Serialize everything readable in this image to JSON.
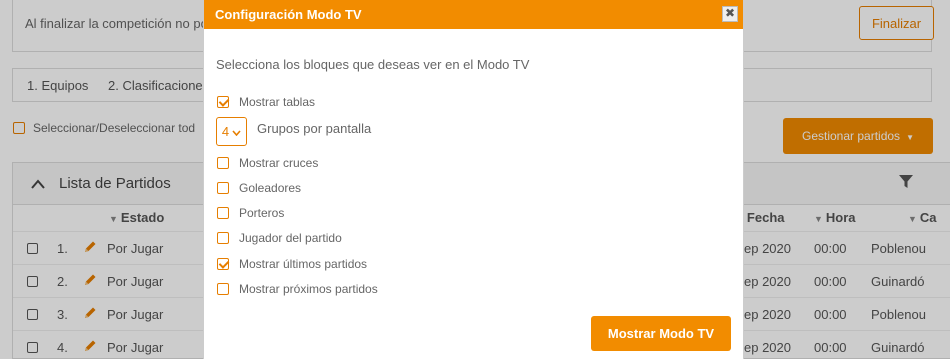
{
  "page": {
    "notice_text": "Al finalizar la competición no po",
    "finalize_label": "Finalizar",
    "tabs": [
      {
        "label": "1. Equipos"
      },
      {
        "label": "2. Clasificacione"
      }
    ],
    "select_all_label": "Seleccionar/Deseleccionar tod",
    "manage_matches_label": "Gestionar partidos",
    "panel_title": "Lista de Partidos",
    "columns": {
      "estado": "Estado",
      "fecha": "Fecha",
      "hora": "Hora",
      "campo": "Ca"
    },
    "rows": [
      {
        "num": "1.",
        "estado": "Por Jugar",
        "fecha": "ep 2020",
        "hora": "00:00",
        "campo": "Poblenou"
      },
      {
        "num": "2.",
        "estado": "Por Jugar",
        "fecha": "ep 2020",
        "hora": "00:00",
        "campo": "Guinardó"
      },
      {
        "num": "3.",
        "estado": "Por Jugar",
        "fecha": "ep 2020",
        "hora": "00:00",
        "campo": "Poblenou"
      },
      {
        "num": "4.",
        "estado": "Por Jugar",
        "fecha": "ep 2020",
        "hora": "00:00",
        "campo": "Guinardó"
      }
    ]
  },
  "modal": {
    "title": "Configuración Modo TV",
    "close_glyph": "✖",
    "intro": "Selecciona los bloques que deseas ver en el Modo TV",
    "groups_value": "4",
    "groups_label": "Grupos por pantalla",
    "options": [
      {
        "label": "Mostrar tablas",
        "checked": true
      },
      {
        "label": "Mostrar cruces",
        "checked": false
      },
      {
        "label": "Goleadores",
        "checked": false
      },
      {
        "label": "Porteros",
        "checked": false
      },
      {
        "label": "Jugador del partido",
        "checked": false
      },
      {
        "label": "Mostrar últimos partidos",
        "checked": true
      },
      {
        "label": "Mostrar próximos partidos",
        "checked": false
      }
    ],
    "submit_label": "Mostrar Modo TV"
  },
  "colors": {
    "accent": "#f28c00",
    "overlay": "rgba(0,0,0,0.2)"
  }
}
